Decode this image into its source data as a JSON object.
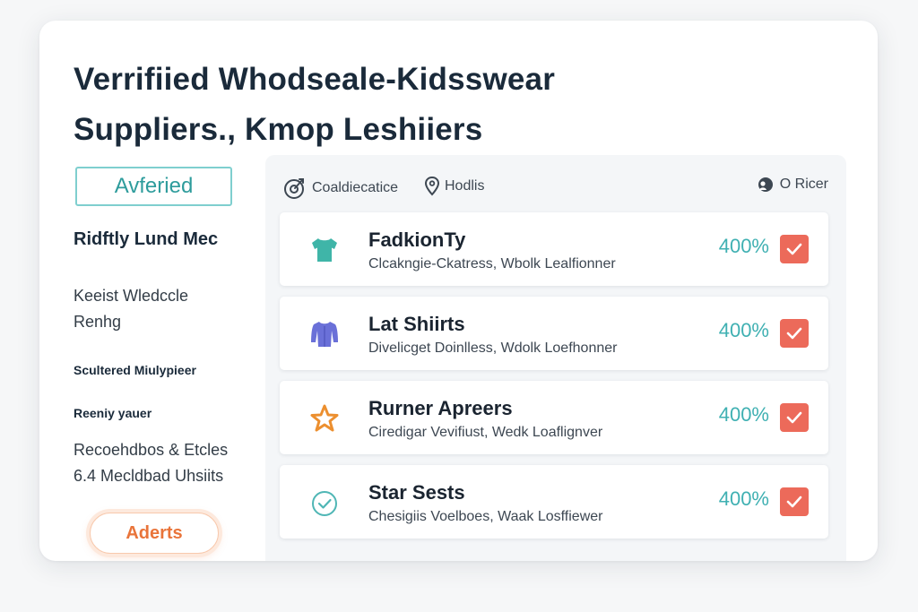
{
  "header": {
    "title_line1": "Verrifiied Whodseale-Kidsswear",
    "title_line2": "Suppliers., Kmop Leshiiers"
  },
  "sidebar": {
    "badge": "Avferied",
    "heading": "Ridftly Lund Mec",
    "text1_line1": "Keeist Wledccle",
    "text1_line2": "Renhg",
    "small1": "Scultered Miulypieer",
    "small2": "Reeniy yauer",
    "text2_line1": "Recoehdbos & Etcles",
    "text2_line2": "6.4 Mecldbad Uhsiits",
    "alerts_button": "Aderts"
  },
  "toolbar": {
    "left1": "Coaldiecatice",
    "left2": "Hodlis",
    "right": "O Ricer",
    "left1_icon": "target-icon",
    "left2_icon": "location-pin-icon",
    "right_icon": "user-toggle-icon"
  },
  "suppliers": [
    {
      "title": "FadkionTy",
      "subtitle": "Clcakngie-Ckatress, Wbolk Lealfionner",
      "percent": "400%",
      "icon": "tshirt-icon",
      "icon_color": "#3fb5a8",
      "checked": true
    },
    {
      "title": "Lat Shiirts",
      "subtitle": "Divelicget Doinlless, Wdolk Loefhonner",
      "percent": "400%",
      "icon": "sweater-icon",
      "icon_color": "#6a70d8",
      "checked": true
    },
    {
      "title": "Rurner Apreers",
      "subtitle": "Ciredigar Vevifiust, Wedk Loaflignver",
      "percent": "400%",
      "icon": "star-icon",
      "icon_color": "#ec8f2f",
      "checked": true
    },
    {
      "title": "Star Sests",
      "subtitle": "Chesigiis Voelboes, Waak Losffiewer",
      "percent": "400%",
      "icon": "check-circle-icon",
      "icon_color": "#4fb6b5",
      "checked": true
    }
  ],
  "colors": {
    "accent_teal": "#3fb0b2",
    "check_red": "#ec6a5a",
    "alert_orange": "#e9743a"
  }
}
